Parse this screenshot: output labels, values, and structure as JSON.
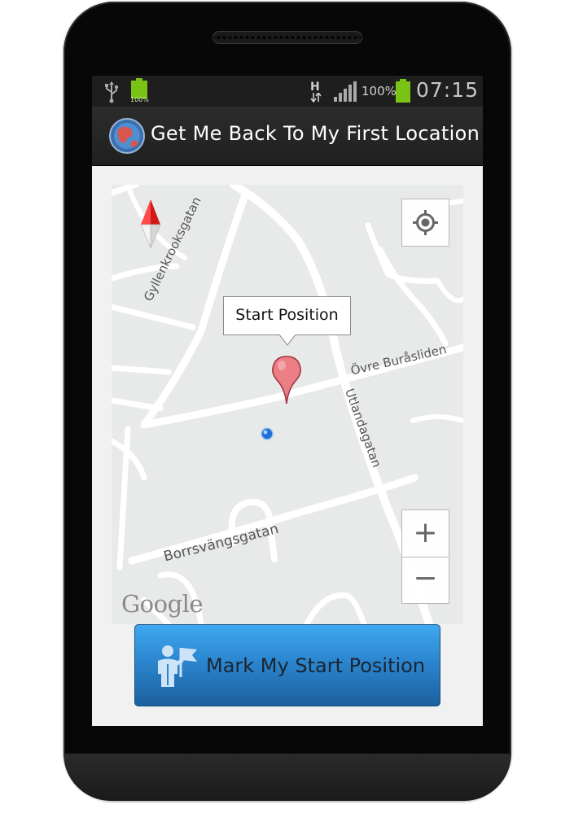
{
  "status_bar": {
    "battery_small_label": "100%",
    "network_type": "H",
    "battery_percent": "100%",
    "time": "07:15"
  },
  "action_bar": {
    "title": "Get Me Back To My First Location",
    "app_icon": "globe-icon"
  },
  "map": {
    "callout_title": "Start Position",
    "streets": [
      "Gyllenkrooksgatan",
      "Övre Buråsliden",
      "Utlandagatan",
      "Borrsvängsgatan"
    ],
    "zoom_in_label": "+",
    "zoom_out_label": "−",
    "my_location_icon": "crosshair-icon",
    "compass_icon": "compass-icon",
    "brand": "Google"
  },
  "button": {
    "label": "Mark My Start Position",
    "icon": "person-flag-icon"
  },
  "colors": {
    "map_background": "#e8eaea",
    "road": "#ffffff",
    "button_top": "#3ea8ee",
    "button_bottom": "#1c5f9e",
    "marker": "#e8707a",
    "battery": "#7ac314"
  }
}
